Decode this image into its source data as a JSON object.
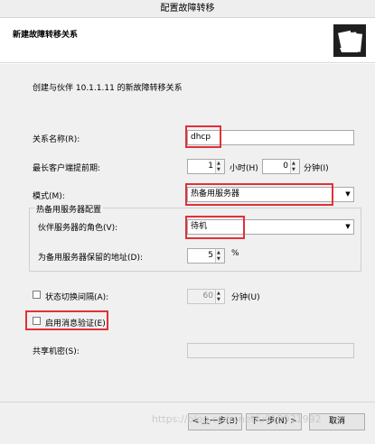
{
  "window": {
    "title": "配置故障转移"
  },
  "header": {
    "title": "新建故障转移关系",
    "icon": "wizard-folder-icon"
  },
  "form": {
    "intro": "创建与伙伴 10.1.1.11 的新故障转移关系",
    "relationship_name_label": "关系名称(R):",
    "relationship_name_value": "dhcp",
    "mclt_label": "最长客户端提前期:",
    "mclt_hours_value": "1",
    "mclt_hours_unit": "小时(H)",
    "mclt_minutes_value": "0",
    "mclt_minutes_unit": "分钟(I)",
    "mode_label": "模式(M):",
    "mode_value": "热备用服务器",
    "hot_standby": {
      "group_title": "热备用服务器配置",
      "role_label": "伙伴服务器的角色(V):",
      "role_value": "待机",
      "reserve_label": "为备用服务器保留的地址(D):",
      "reserve_value": "5",
      "reserve_unit": "%"
    },
    "state_switchover_label": "状态切换间隔(A):",
    "state_switchover_value": "60",
    "state_switchover_unit": "分钟(U)",
    "state_switchover_checked": false,
    "enable_auth_label": "启用消息验证(E)",
    "enable_auth_checked": false,
    "shared_secret_label": "共享机密(S):",
    "shared_secret_value": ""
  },
  "footer": {
    "back_label": "< 上一步(B)",
    "next_label": "下一步(N) >",
    "cancel_label": "取消"
  },
  "watermark": "https://blog.csdn.net/u013931992",
  "colors": {
    "highlight_box": "#e0313a",
    "dialog_bg": "#f0f0f0"
  }
}
